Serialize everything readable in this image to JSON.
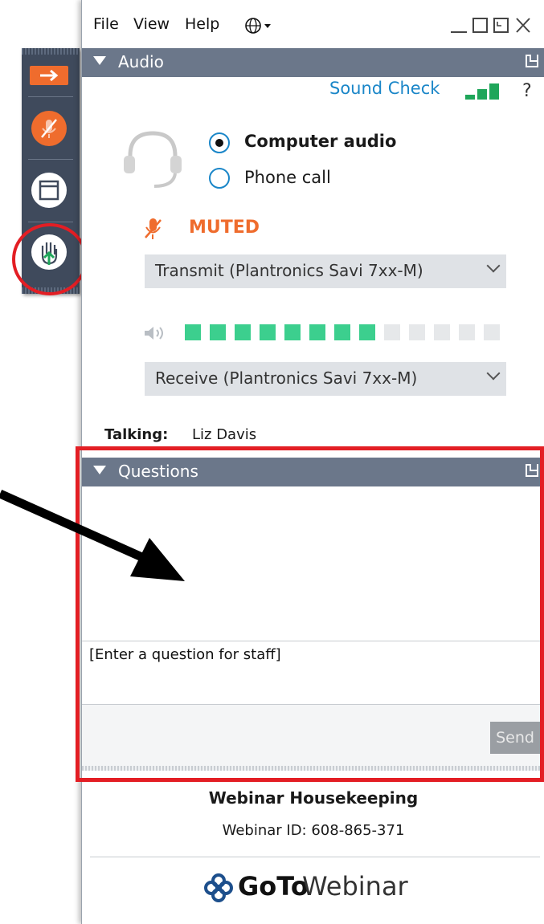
{
  "menubar": {
    "items": [
      "File",
      "View",
      "Help"
    ],
    "globe_icon": "globe-icon",
    "window_controls": [
      "minimize",
      "maximize",
      "popout",
      "close"
    ]
  },
  "audio_panel": {
    "title": "Audio",
    "sound_check": "Sound Check",
    "help": "?",
    "options": [
      {
        "label": "Computer audio",
        "selected": true
      },
      {
        "label": "Phone call",
        "selected": false
      }
    ],
    "status": "MUTED",
    "transmit_device": "Transmit (Plantronics Savi 7xx-M)",
    "receive_device": "Receive (Plantronics Savi 7xx-M)",
    "receive_level": {
      "filled": 8,
      "total": 13
    },
    "talking_label": "Talking:",
    "talking_name": "Liz Davis"
  },
  "questions_panel": {
    "title": "Questions",
    "input_placeholder": "[Enter a question for staff]",
    "send_label": "Send"
  },
  "footer": {
    "title": "Webinar Housekeeping",
    "webinar_id": "Webinar ID: 608-865-371",
    "brand_bold": "GoTo",
    "brand_rest": "Webinar"
  },
  "colors": {
    "accent_orange": "#ef6c2d",
    "link_blue": "#1a86c8",
    "level_green": "#3ccf8e",
    "highlight_red": "#e31e24",
    "panel_header": "#6b778a"
  }
}
